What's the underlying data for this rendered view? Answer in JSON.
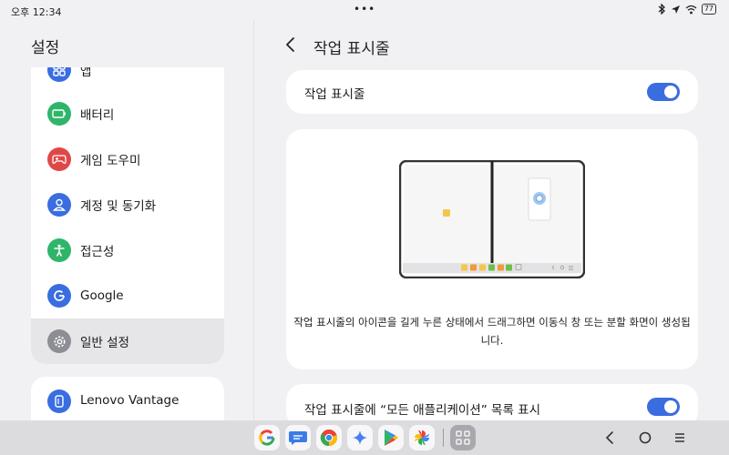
{
  "status": {
    "time": "오후 12:34",
    "dots": "•••",
    "battery": "77"
  },
  "left": {
    "title": "설정",
    "items": [
      {
        "label": "앱",
        "icon": "apps-icon",
        "color": "#3a6de0"
      },
      {
        "label": "배터리",
        "icon": "battery-icon",
        "color": "#2fb56a"
      },
      {
        "label": "게임 도우미",
        "icon": "gamepad-icon",
        "color": "#e04848"
      },
      {
        "label": "계정 및 동기화",
        "icon": "account-icon",
        "color": "#3a6de0"
      },
      {
        "label": "접근성",
        "icon": "accessibility-icon",
        "color": "#2fb56a"
      },
      {
        "label": "Google",
        "icon": "google-icon",
        "color": "#3a6de0"
      },
      {
        "label": "일반 설정",
        "icon": "gear-icon",
        "color": "#8d8d94"
      }
    ],
    "extra_item": {
      "label": "Lenovo Vantage",
      "icon": "lenovo-vantage-icon",
      "color": "#3a6de0"
    }
  },
  "main": {
    "title": "작업 표시줄",
    "taskbar_toggle_label": "작업 표시줄",
    "description": "작업 표시줄의 아이콘을 길게 누른 상태에서 드래그하면 이동식 창 또는 분할 화면이 생성됩니다.",
    "all_apps_toggle_label": "작업 표시줄에 “모든 애플리케이션” 목록 표시",
    "taskbar_toggle_on": true,
    "all_apps_toggle_on": true
  },
  "colors": {
    "accent": "#3a6de0",
    "background": "#f1f1f3",
    "card": "#ffffff"
  },
  "dock": [
    "google-icon",
    "messages-icon",
    "chrome-icon",
    "gemini-icon",
    "play-store-icon",
    "photos-icon",
    "all-apps-icon"
  ]
}
